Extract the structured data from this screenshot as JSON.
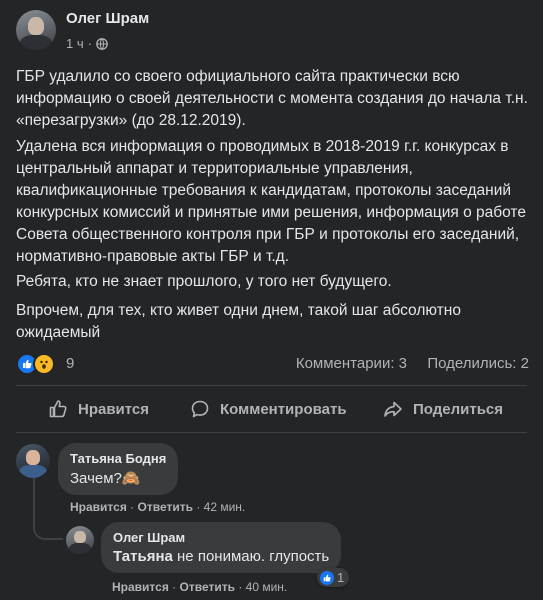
{
  "post": {
    "author": "Олег Шрам",
    "time": "1 ч",
    "dot": "·",
    "paragraphs": [
      "ГБР удалило со своего официального сайта практически всю информацию о своей деятельности с момента создания до начала т.н. «перезагрузки» (до 28.12.2019).",
      "Удалена вся информация о проводимых в 2018-2019 г.г. конкурсах в центральный аппарат и территориальные управления, квалификационные требования к кандидатам, протоколы заседаний конкурсных комиссий и принятые ими решения, информация о работе Совета общественного контроля при ГБР и протоколы его заседаний, нормативно-правовые акты ГБР и т.д.",
      "Ребята, кто не знает прошлого, у того нет будущего.",
      "Впрочем, для тех, кто живет одни днем, такой шаг абсолютно ожидаемый"
    ],
    "reactions": {
      "count": "9",
      "icons": [
        "like-icon",
        "wow-icon"
      ]
    },
    "comments_count": "Комментарии: 3",
    "shares_count": "Поделились: 2"
  },
  "actions": {
    "like": "Нравится",
    "comment": "Комментировать",
    "share": "Поделиться"
  },
  "comments": [
    {
      "author": "Татьяна Бодня",
      "text": "Зачем?🙈",
      "like": "Нравится",
      "reply": "Ответить",
      "time": "42 мин."
    },
    {
      "author": "Олег Шрам",
      "mention": "Татьяна",
      "text": " не понимаю. глупость",
      "like": "Нравится",
      "reply": "Ответить",
      "time": "40 мин.",
      "reaction_count": "1"
    }
  ],
  "colors": {
    "background": "#242526",
    "bubble": "#3a3b3c",
    "text": "#e4e6eb",
    "muted": "#b0b3b8",
    "like": "#1877f2"
  }
}
